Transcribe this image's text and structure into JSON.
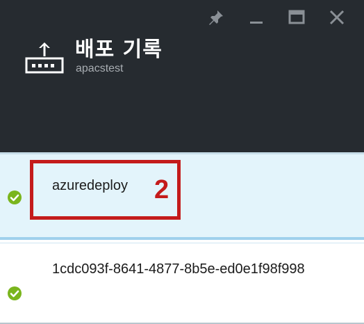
{
  "header": {
    "title": "배포 기록",
    "subtitle": "apacstest",
    "icon": "deployment-upload-icon",
    "controls": [
      "pin-icon",
      "minimize-icon",
      "maximize-icon",
      "close-icon"
    ]
  },
  "deployments": [
    {
      "name": "azuredeploy",
      "status": "succeeded",
      "status_icon": "check-circle-icon",
      "selected": true
    },
    {
      "name": "1cdc093f-8641-4877-8b5e-ed0e1f98f998",
      "status": "succeeded",
      "status_icon": "check-circle-icon",
      "selected": false
    }
  ],
  "annotation": {
    "label": "2"
  },
  "colors": {
    "header_bg": "#262b30",
    "selected_row_bg": "#e3f4fb",
    "success_green": "#7ab51d",
    "annotation_red": "#c41b1b"
  }
}
